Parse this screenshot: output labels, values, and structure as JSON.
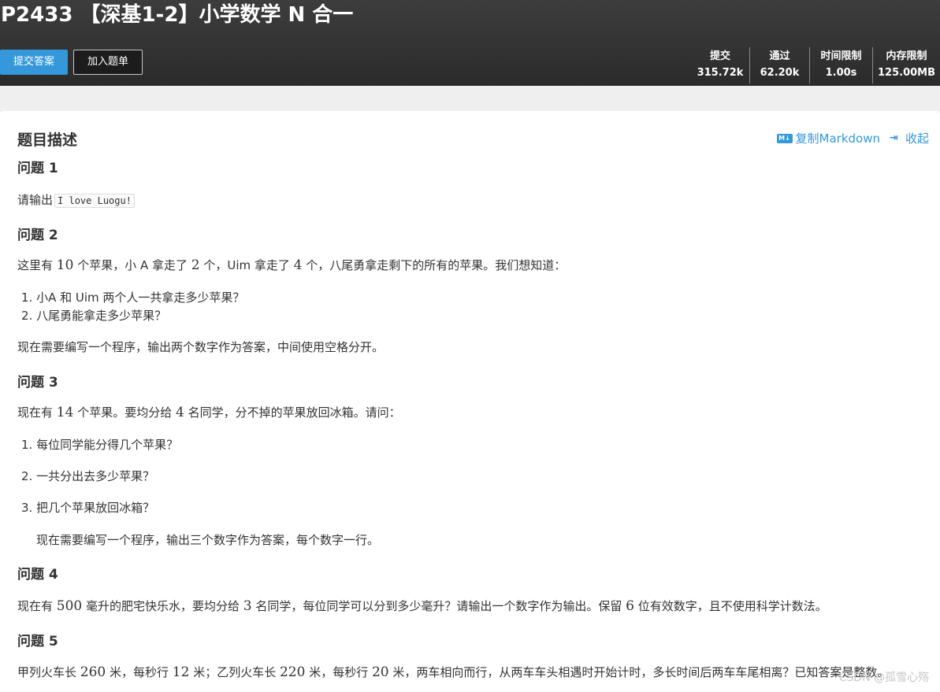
{
  "problem": {
    "title": "P2433 【深基1-2】小学数学 N 合一",
    "submit_label": "提交答案",
    "add_label": "加入题单",
    "stats": [
      {
        "label": "提交",
        "value": "315.72k"
      },
      {
        "label": "通过",
        "value": "62.20k"
      },
      {
        "label": "时间限制",
        "value": "1.00s"
      },
      {
        "label": "内存限制",
        "value": "125.00MB"
      }
    ]
  },
  "content": {
    "heading": "题目描述",
    "copy_md_icon": "M↓",
    "copy_md_label": "复制Markdown",
    "collapse_label": "收起",
    "q1": {
      "title": "问题 1",
      "text": "请输出",
      "code": "I love Luogu!"
    },
    "q2": {
      "title": "问题 2",
      "p1": [
        "这里有 ",
        "10",
        " 个苹果，小 A 拿走了 ",
        "2",
        " 个，Uim 拿走了 ",
        "4",
        " 个，八尾勇拿走剩下的所有的苹果。我们想知道："
      ],
      "items": [
        "1. 小A 和 Uim 两个人一共拿走多少苹果？",
        "2. 八尾勇能拿走多少苹果？"
      ],
      "p2": "现在需要编写一个程序，输出两个数字作为答案，中间使用空格分开。"
    },
    "q3": {
      "title": "问题 3",
      "p1": [
        "现在有 ",
        "14",
        " 个苹果。要均分给 ",
        "4",
        " 名同学，分不掉的苹果放回冰箱。请问："
      ],
      "items": [
        "1. 每位同学能分得几个苹果？",
        "2. 一共分出去多少苹果？",
        "3. 把几个苹果放回冰箱？"
      ],
      "p2": "现在需要编写一个程序，输出三个数字作为答案，每个数字一行。"
    },
    "q4": {
      "title": "问题 4",
      "p1": [
        "现在有 ",
        "500",
        " 毫升的肥宅快乐水，要均分给 ",
        "3",
        " 名同学，每位同学可以分到多少毫升？请输出一个数字作为输出。保留 ",
        "6",
        " 位有效数字，且不使用科学计数法。"
      ]
    },
    "q5": {
      "title": "问题 5",
      "p1": [
        "甲列火车长 ",
        "260",
        " 米，每秒行 ",
        "12",
        " 米；乙列火车长 ",
        "220",
        " 米，每秒行 ",
        "20",
        " 米，两车相向而行，从两车车头相遇时开始计时，多长时间后两车车尾相离？已知答案是整数。"
      ]
    }
  },
  "watermark": "CSDN @孤雪心殇"
}
